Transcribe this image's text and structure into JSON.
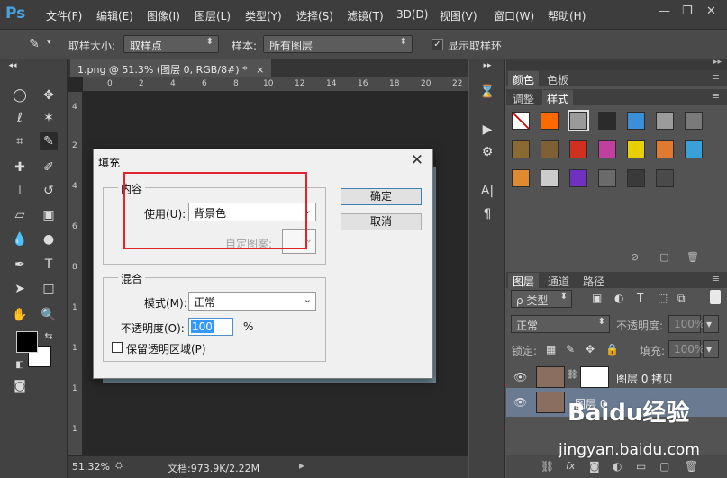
{
  "app": {
    "logo": "Ps",
    "menu": [
      "文件(F)",
      "编辑(E)",
      "图像(I)",
      "图层(L)",
      "类型(Y)",
      "选择(S)",
      "滤镜(T)",
      "3D(D)",
      "视图(V)",
      "窗口(W)",
      "帮助(H)"
    ],
    "window_controls": {
      "minimize": "—",
      "restore": "❐",
      "close": "✕"
    }
  },
  "options_bar": {
    "sample_size_label": "取样大小:",
    "sample_size_value": "取样点",
    "sample_label": "样本:",
    "sample_value": "所有图层",
    "show_ring_label": "显示取样环",
    "show_ring_checked": "✓"
  },
  "document": {
    "tab_title": "1.png @ 51.3% (图层 0, RGB/8#) *",
    "tab_close": "×",
    "ruler_h": [
      "0",
      "2",
      "4",
      "6",
      "8",
      "10",
      "12",
      "14",
      "16",
      "18",
      "20",
      "22"
    ],
    "ruler_v": [
      "4",
      "2",
      "4",
      "6",
      "8",
      "1",
      "1",
      "1",
      "1"
    ],
    "zoom": "51.32%",
    "doc_info": "文档:973.9K/2.22M"
  },
  "fill_dialog": {
    "title": "填充",
    "close": "✕",
    "content_group": "内容",
    "use_label": "使用(U):",
    "use_value": "背景色",
    "custom_pattern_label": "自定图案:",
    "ok_label": "确定",
    "cancel_label": "取消",
    "blend_group": "混合",
    "mode_label": "模式(M):",
    "mode_value": "正常",
    "opacity_label": "不透明度(O):",
    "opacity_value": "100",
    "opacity_unit": "%",
    "preserve_label": "保留透明区域(P)"
  },
  "panels": {
    "color_tab": "颜色",
    "swatches_tab": "色板",
    "adjust_tab": "调整",
    "styles_tab": "样式",
    "layers_tab": "图层",
    "channels_tab": "通道",
    "paths_tab": "路径",
    "kind_filter": "ρ 类型",
    "blend_mode": "正常",
    "opacity_label": "不透明度:",
    "opacity_value": "100%",
    "lock_label": "锁定:",
    "fill_label": "填充:",
    "fill_value": "100%",
    "layers": [
      {
        "name": "图层 0 拷贝"
      },
      {
        "name": "图层 0"
      }
    ],
    "style_colors": [
      "#ffffff",
      "#ff6a00",
      "#9a9a9a",
      "#2b2b2b",
      "#3a8fd8",
      "#9b9b9b",
      "#7a7a7a",
      "#8a6a30",
      "#7d6035",
      "#d03020",
      "#c040a0",
      "#e8d000",
      "#e07a30",
      "#3aa0d8",
      "#e08a30",
      "#cccccc",
      "#7030c0",
      "#6a6a6a",
      "#3a3a3a",
      "#4a4a4a"
    ]
  },
  "watermark": {
    "brand": "Baidu经验",
    "url": "jingyan.baidu.com"
  }
}
